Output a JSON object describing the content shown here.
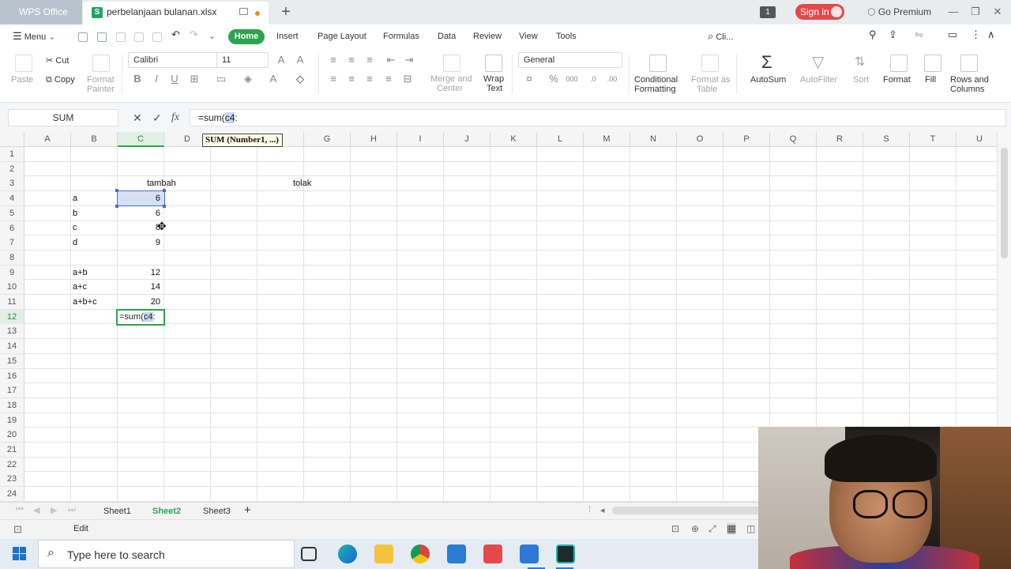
{
  "titlebar": {
    "app_tab": "WPS Office",
    "doc_tab": "perbelanjaan bulanan.xlsx",
    "tab_count": "1",
    "sign_in": "Sign in",
    "go_premium": "Go Premium"
  },
  "menubar": {
    "menu": "Menu",
    "tabs": [
      "Home",
      "Insert",
      "Page Layout",
      "Formulas",
      "Data",
      "Review",
      "View",
      "Tools"
    ],
    "search": "Cli..."
  },
  "ribbon": {
    "paste": "Paste",
    "cut": "Cut",
    "copy": "Copy",
    "format_painter_1": "Format",
    "format_painter_2": "Painter",
    "font_name": "Calibri",
    "font_size": "11",
    "merge_1": "Merge and",
    "merge_2": "Center",
    "wrap_1": "Wrap",
    "wrap_2": "Text",
    "number_format": "General",
    "cond_1": "Conditional",
    "cond_2": "Formatting",
    "fmt_table_1": "Format as",
    "fmt_table_2": "Table",
    "autosum": "AutoSum",
    "autofilter": "AutoFilter",
    "sort": "Sort",
    "format": "Format",
    "fill": "Fill",
    "rows_cols_1": "Rows and",
    "rows_cols_2": "Columns"
  },
  "formula_bar": {
    "name_box": "SUM",
    "formula_prefix": "=sum(",
    "formula_highlight": "c4",
    "formula_suffix": ":"
  },
  "tooltip": "SUM (Number1, ...)",
  "columns": [
    "A",
    "B",
    "C",
    "D",
    "E",
    "F",
    "G",
    "H",
    "I",
    "J",
    "K",
    "L",
    "M",
    "N",
    "O",
    "P",
    "Q",
    "R",
    "S",
    "T",
    "U"
  ],
  "rows": [
    "1",
    "2",
    "3",
    "4",
    "5",
    "6",
    "7",
    "8",
    "9",
    "10",
    "11",
    "12",
    "13",
    "14",
    "15",
    "16",
    "17",
    "18",
    "19",
    "20",
    "21",
    "22",
    "23",
    "24"
  ],
  "cells": {
    "c3": "tambah",
    "f3": "tolak",
    "b4": "a",
    "c4": "6",
    "b5": "b",
    "c5": "6",
    "b6": "c",
    "c6": "8",
    "b7": "d",
    "c7": "9",
    "b9": "a+b",
    "c9": "12",
    "b10": "a+c",
    "c10": "14",
    "b11": "a+b+c",
    "c11": "20",
    "c12_prefix": "=sum(",
    "c12_highlight": "c4",
    "c12_suffix": ":"
  },
  "sheets": [
    "Sheet1",
    "Sheet2",
    "Sheet3"
  ],
  "active_sheet": "Sheet2",
  "status": "Edit",
  "taskbar": {
    "search_placeholder": "Type here to search"
  },
  "colors": {
    "accent": "#2da44e",
    "selection": "#d5e1f3",
    "sign_in": "#e34949"
  }
}
